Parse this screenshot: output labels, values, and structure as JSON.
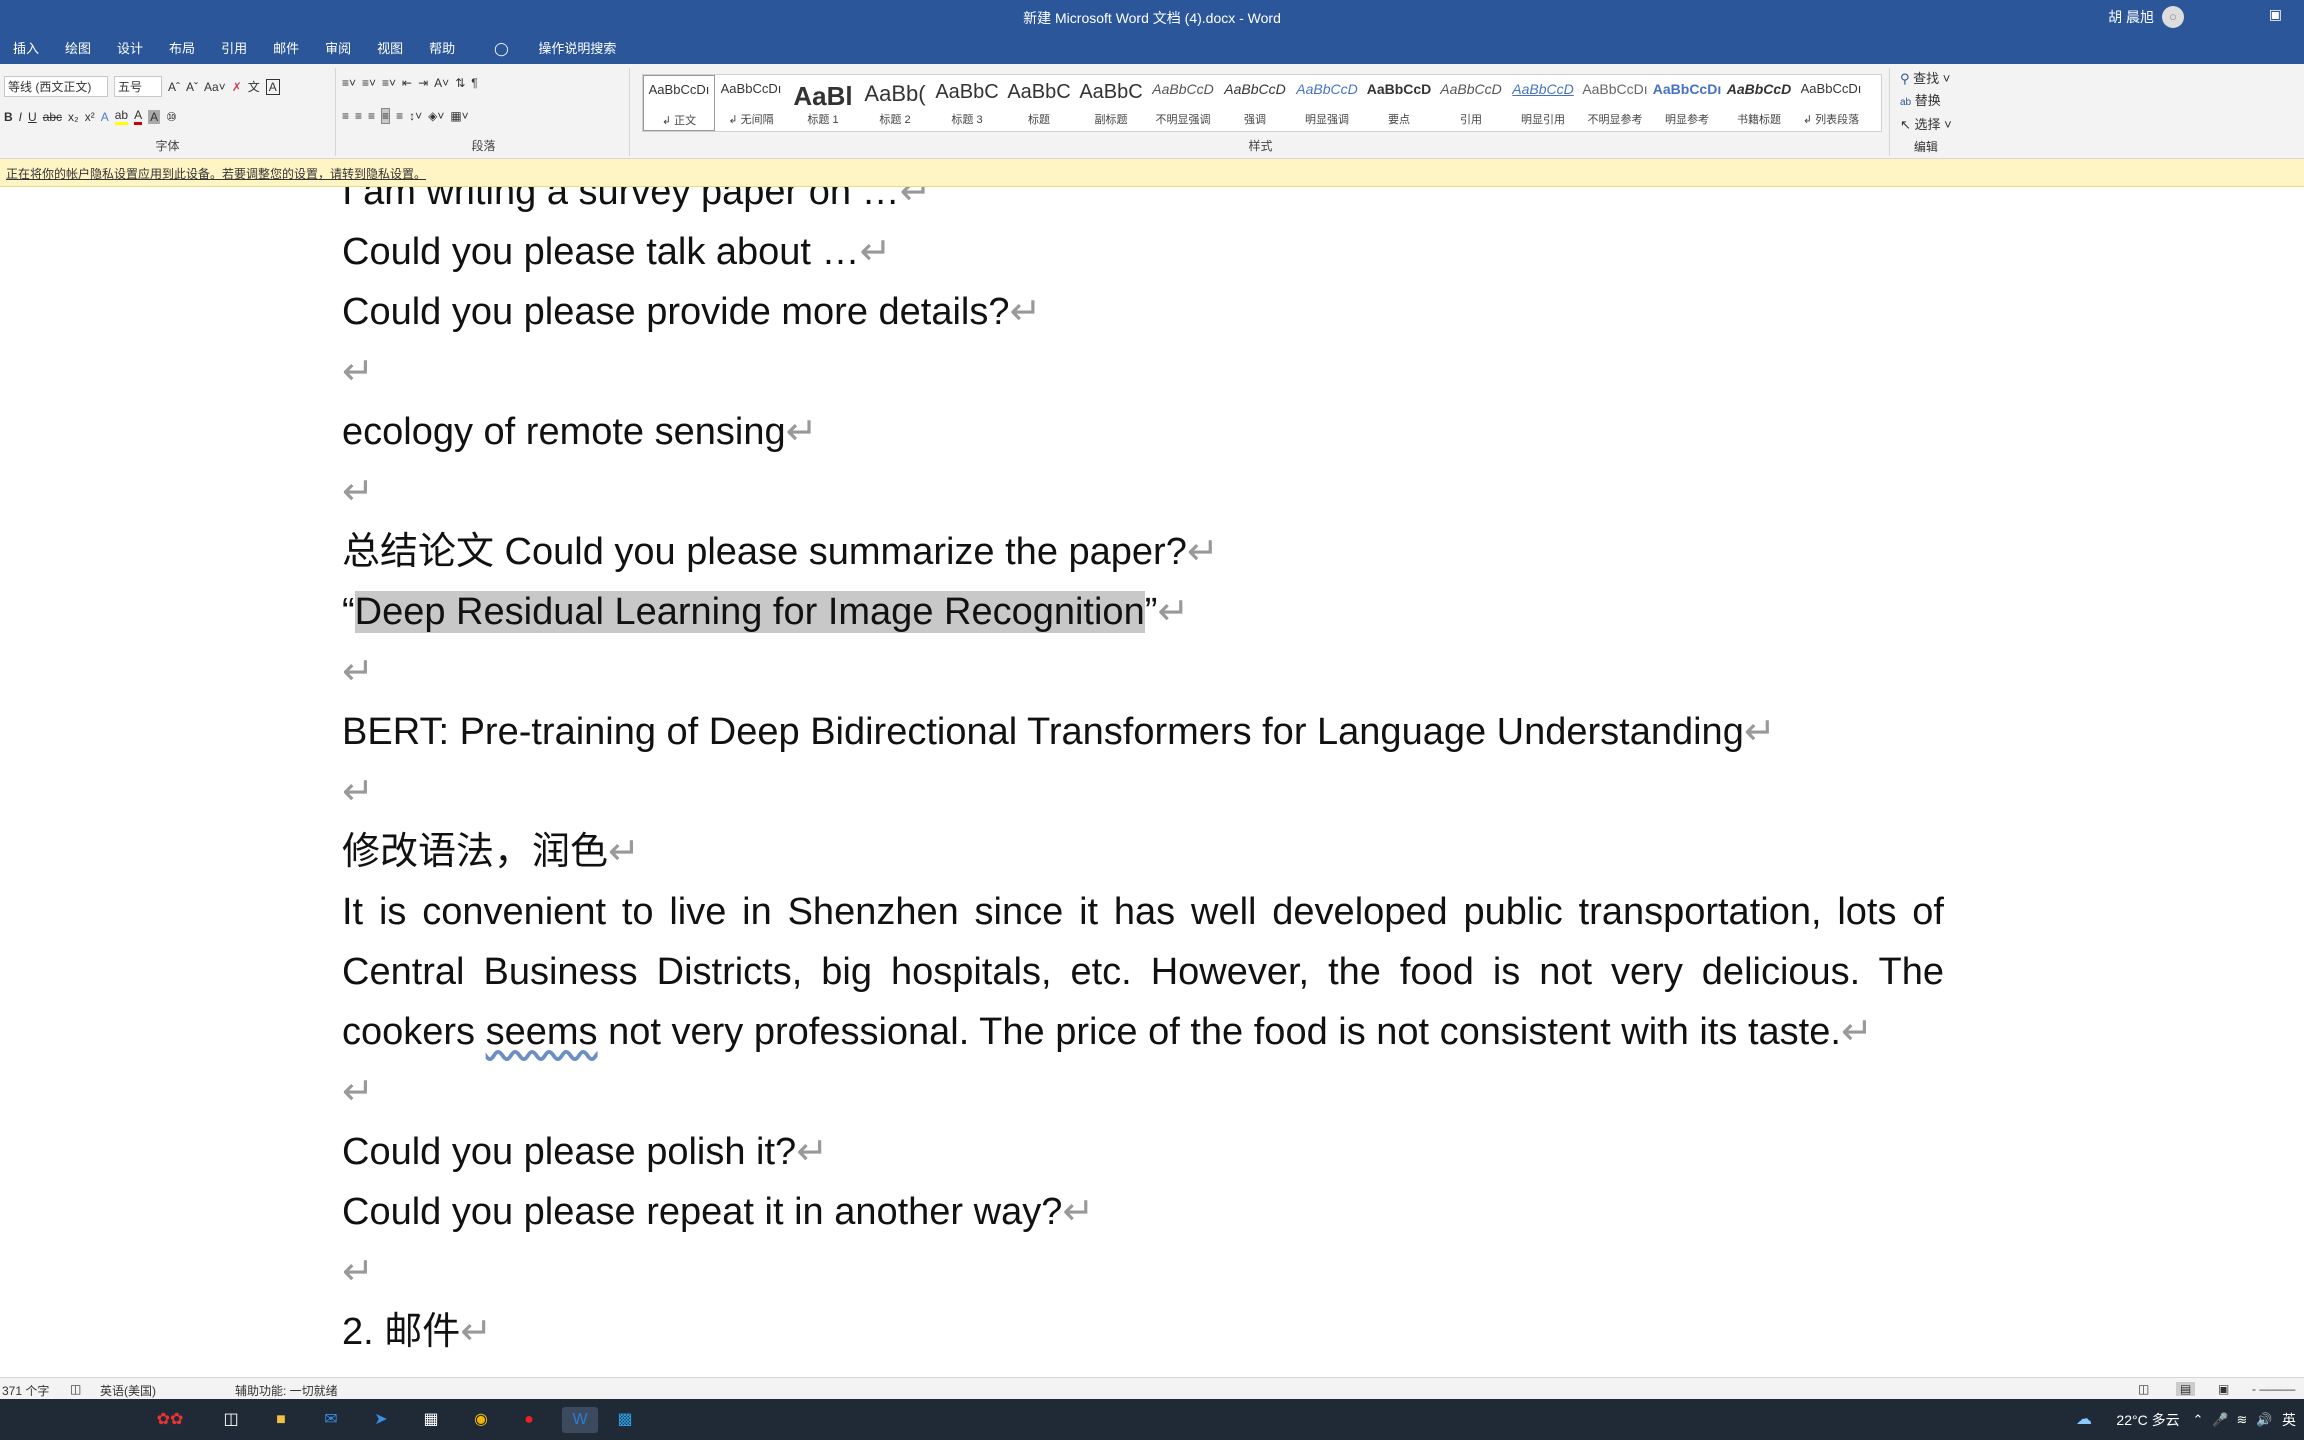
{
  "window": {
    "title": "新建 Microsoft Word 文档 (4).docx  -  Word",
    "user": "胡 晨旭"
  },
  "tabs": [
    "插入",
    "绘图",
    "设计",
    "布局",
    "引用",
    "邮件",
    "审阅",
    "视图",
    "帮助"
  ],
  "tell_me": "操作说明搜索",
  "ribbon": {
    "font": {
      "name": "等线 (西文正文)",
      "size": "五号",
      "label": "字体"
    },
    "paragraph": {
      "label": "段落"
    },
    "styles": {
      "label": "样式",
      "items": [
        {
          "preview": "AaBbCcDı",
          "name": "↲ 正文",
          "selected": true
        },
        {
          "preview": "AaBbCcDı",
          "name": "↲ 无间隔"
        },
        {
          "preview": "AaBl",
          "name": "标题 1"
        },
        {
          "preview": "AaBb(",
          "name": "标题 2"
        },
        {
          "preview": "AaBbC",
          "name": "标题 3"
        },
        {
          "preview": "AaBbC",
          "name": "标题"
        },
        {
          "preview": "AaBbC",
          "name": "副标题"
        },
        {
          "preview": "AaBbCcD",
          "name": "不明显强调"
        },
        {
          "preview": "AaBbCcD",
          "name": "强调"
        },
        {
          "preview": "AaBbCcD",
          "name": "明显强调"
        },
        {
          "preview": "AaBbCcD",
          "name": "要点"
        },
        {
          "preview": "AaBbCcD",
          "name": "引用"
        },
        {
          "preview": "AaBbCcD",
          "name": "明显引用"
        },
        {
          "preview": "AaBbCcDı",
          "name": "不明显参考"
        },
        {
          "preview": "AaBbCcDı",
          "name": "明显参考"
        },
        {
          "preview": "AaBbCcD",
          "name": "书籍标题"
        },
        {
          "preview": "AaBbCcDı",
          "name": "↲ 列表段落"
        }
      ]
    },
    "editing": {
      "label": "编辑",
      "find": "查找",
      "replace": "替换",
      "select": "选择"
    }
  },
  "notice": "正在将你的帐户隐私设置应用到此设备。若要调整您的设置，请转到隐私设置。",
  "document": {
    "lines": [
      "I am writing a survey paper on …",
      "Could you please talk about …",
      "Could you please provide more details?",
      "",
      "ecology of remote sensing",
      "",
      "总结论文  Could you please summarize the paper?"
    ],
    "quote_open": "“",
    "quote_title": "Deep Residual Learning for Image Recognition",
    "quote_close": "”",
    "bert": "BERT: Pre-training of Deep Bidirectional Transformers for Language Understanding",
    "heading_cn": "修改语法，润色",
    "para_before": "It is convenient to live in Shenzhen since it has well developed public transportation, lots of Central Business Districts, big hospitals, etc. However, the food is not very delicious. The cookers ",
    "para_error": "seems",
    "para_after": " not very professional. The price of the food is not consistent with its taste.",
    "polish": "Could you please polish it?",
    "repeat": "Could you please repeat it in another way?",
    "section": "2.  邮件",
    "para_mark": "↵"
  },
  "status": {
    "word_count": "371 个字",
    "language": "英语(美国)",
    "accessibility": "辅助功能: 一切就绪"
  },
  "taskbar": {
    "weather": "22°C 多云",
    "ime": "英"
  }
}
